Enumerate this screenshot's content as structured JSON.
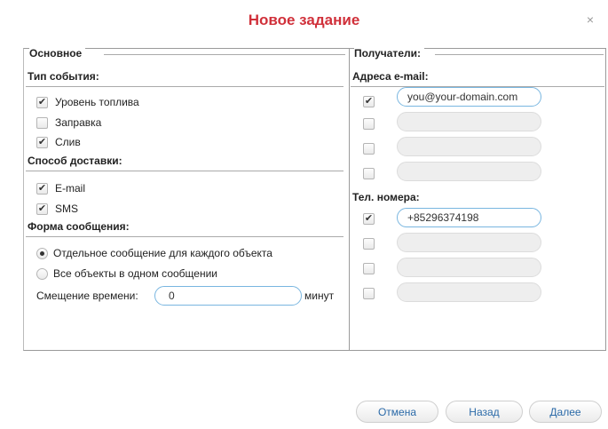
{
  "dialog": {
    "title": "Новое задание",
    "close_glyph": "×"
  },
  "left": {
    "legend": "Основное",
    "event_type": {
      "title": "Тип события:",
      "items": [
        {
          "label": "Уровень топлива",
          "checked": true
        },
        {
          "label": "Заправка",
          "checked": false
        },
        {
          "label": "Слив",
          "checked": true
        }
      ]
    },
    "delivery": {
      "title": "Способ доставки:",
      "items": [
        {
          "label": "E-mail",
          "checked": true
        },
        {
          "label": "SMS",
          "checked": true
        }
      ]
    },
    "message_form": {
      "title": "Форма сообщения:",
      "options": [
        {
          "label": "Отдельное сообщение для каждого объекта",
          "selected": true
        },
        {
          "label": "Все объекты в одном сообщении",
          "selected": false
        }
      ]
    },
    "time_offset": {
      "label": "Смещение времени:",
      "value": "0",
      "unit": "минут"
    }
  },
  "right": {
    "legend": "Получатели:",
    "emails": {
      "title": "Адреса e-mail:",
      "items": [
        {
          "checked": true,
          "value": "you@your-domain.com"
        },
        {
          "checked": false,
          "value": ""
        },
        {
          "checked": false,
          "value": ""
        },
        {
          "checked": false,
          "value": ""
        }
      ]
    },
    "phones": {
      "title": "Тел. номера:",
      "items": [
        {
          "checked": true,
          "value": "+85296374198"
        },
        {
          "checked": false,
          "value": ""
        },
        {
          "checked": false,
          "value": ""
        },
        {
          "checked": false,
          "value": ""
        }
      ]
    }
  },
  "footer": {
    "cancel_label": "Отмена",
    "back_label": "Назад",
    "next_label": "Далее"
  },
  "check_glyph": "✔",
  "colors": {
    "title": "#d0303a",
    "button_text": "#2b6aa8",
    "input_border": "#79b6e0"
  }
}
